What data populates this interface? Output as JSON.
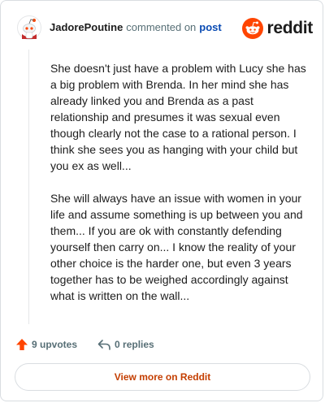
{
  "header": {
    "author": "JadorePoutine",
    "action": "commented on",
    "link": "post",
    "brand": "reddit"
  },
  "comment": {
    "paragraphs": [
      "She doesn't just have a problem with Lucy she has a big problem with Brenda. In her mind she has already linked you and Brenda as a past relationship and presumes it was sexual even though clearly not the case to a rational person. I think she sees you as hanging with your child but you ex as well...",
      "She will always have an issue with women in your life and assume something is up between you and them... If you are ok with constantly defending yourself then carry on... I know the reality of your other choice is the harder one, but even 3 years together has to be weighed accordingly against what is written on the wall..."
    ]
  },
  "footer": {
    "upvotes_label": "9 upvotes",
    "replies_label": "0 replies",
    "upvote_icon": "upvote-arrow-icon",
    "reply_icon": "reply-arrow-icon"
  },
  "cta": {
    "label": "View more on Reddit"
  },
  "colors": {
    "accent": "#ff4500",
    "link": "#0a4bb3",
    "cta_text": "#c43e00",
    "muted": "#576f76"
  }
}
